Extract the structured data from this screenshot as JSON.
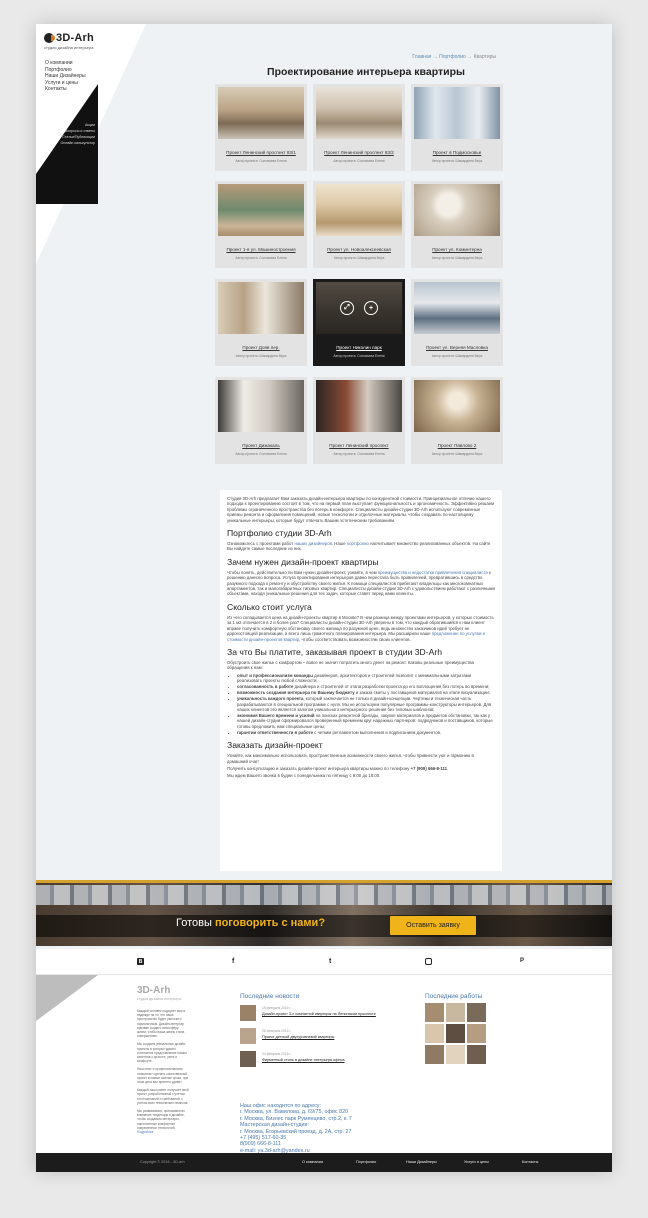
{
  "sidebar": {
    "logo": "3D-Arh",
    "logo_sub": "студия дизайна интерьера",
    "menu_top": [
      "О компании",
      "Портфолио",
      "Наши Дизайнеры",
      "Услуги и цены",
      "Контакты"
    ],
    "menu_bottom": [
      "Акции",
      "Вопросы и ответы",
      "Статьи/Публикации",
      "Онлайн калькулятор"
    ]
  },
  "breadcrumb": {
    "home": "Главная",
    "sep1": " → ",
    "portfolio": "Портфолио",
    "sep2": " → ",
    "current": "Квартиры"
  },
  "page_title": "Проектирование интерьера квартиры",
  "projects": [
    {
      "name": "Проект Ленинский проспект 83/1",
      "author": "Автор проекта: Соловьева Елена"
    },
    {
      "name": "Проект Ленинский проспект 83/2",
      "author": "Автор проекта: Соловьева Елена"
    },
    {
      "name": "Проект в Подмосковье",
      "author": "Автор проекта: Шамардина Вера"
    },
    {
      "name": "Проект 1-я ул. Машиностроения",
      "author": "Автор проекта: Соловьева Елена"
    },
    {
      "name": "Проект ул. Новоалексеевская",
      "author": "Автор проекта: Шамардина Вера"
    },
    {
      "name": "Проект ул. Коминтерна",
      "author": "Автор проекта: Шамардина Вера"
    },
    {
      "name": "Проект Дояв пер.",
      "author": "Автор проекта: Шамардина Вера"
    },
    {
      "name": "Проект Николин парк",
      "author": "Автор проекта: Соловьева Елена"
    },
    {
      "name": "Проект ул. Верняя Масловка",
      "author": "Автор проекта: Шамардина Вера"
    },
    {
      "name": "Проект Дижакаль",
      "author": "Автор проекта: Соловьева Елена"
    },
    {
      "name": "Проект Ленинский проспект",
      "author": "Автор проекта: Соловьева Елена"
    },
    {
      "name": "Проект Павлово 2",
      "author": "Автор проекта: Шамардина Вера"
    }
  ],
  "article": {
    "intro": "Студия 3D-Arh предлагает Вам заказать дизайн-интерьера квартиры по конкурентной стоимости. Принципиальное отличие нашего подхода к проектированию состоит в том, что на первый план выступает функциональность и эргономичность. Эффективно решаем проблемы ограниченного пространства без потерь в комфорте. Специалисты дизайн-студии 3D-Arh используют современные приемы ремонта и оформления помещений, новые технологии и отделочные материалы, чтобы создавать по-настоящему уникальные интерьеры, которые будут отвечать Вашим эстетическим требованиям.",
    "h1": "Портфолио студии 3D-Arh",
    "p1_a": "Ознакомьтесь с проектами работ ",
    "p1_link1": "наших дизайнеров",
    "p1_b": ". Наше ",
    "p1_link2": "портфолио",
    "p1_c": " насчитывает множество реализованных объектов. На сайте Вы найдете самые последние из них.",
    "h2": "Зачем нужен дизайн-проект квартиры",
    "p2_a": "Чтобы понять, действительно ли Вам нужен дизайн-проект, узнайте, в чем ",
    "p2_link": "преимущества и недостатки привлечения специалиста",
    "p2_b": " к решению данного вопроса. Услуга проектирования интерьеров давно перестала быть привилегией, превратившись в средство разумного подхода к ремонту и обустройству своего жилья. К помощи специалистов прибегают владельцы как многокомнатных апартаментов, так и малогабаритных типовых квартир. Специалисты дизайн-студии 3D-Arh с удовольствием работают с различными объектами, находя уникальные решения для тех задач, которые ставят перед нами клиенты.",
    "h3": "Сколько стоит услуга",
    "p3_a": "Из чего складывается цена на дизайн-проекты квартир в Москве? В чем разница между проектами интерьеров, у которых стоимость за 1 м2 отличается в 2 и более раз? Специалисты дизайн-студии 3D-Arh уверены в том, что каждый обратившийся к нам клиент вправе получить комфортную обстановку своего жилища по разумной цене, ведь множество заказчиков идей требует не дорогостоящей реализации, а всего лишь грамотного планирования интерьера. Мы расширили наше ",
    "p3_link": "предложение по услугам и стоимости дизайн-проектов квартир",
    "p3_b": ", чтобы соответствовать возможностям своих клиентов.",
    "h4": "За что Вы платите, заказывая проект в студии 3D-Arh",
    "p4": "Обустроить свое жилье с комфортом – вовсе не значит потратить много денег на ремонт. Каковы реальные преимущества обращения к нам:",
    "list": [
      {
        "b": "опыт и профессионализм команды",
        "t": " дизайнеров, архитекторов и строителей позволит с минимальными затратами реализовать проекты любой сложности;"
      },
      {
        "b": "согласованность в работе",
        "t": " дизайнера и строителей от этапа разработки проекта до его воплощения без потерь во времени;"
      },
      {
        "b": "возможность создания интерьера по Вашему бюджету",
        "t": " и заказа сметы у поставщиков материалов на этапе визуализации;"
      },
      {
        "b": "уникальность каждого проекта",
        "t": ", который заключается не только в дизайн-концепции. Чертежи и техническая часть разрабатываются в специальной программе с нуля. Мы не используем популярные программы-конструкторы интерьеров. Для наших клиентов это является залогом уникального интерьерного решения без типовых шаблонов;"
      },
      {
        "b": "экономия Вашего времени и усилий",
        "t": " на поисках ремонтной бригады, закупке материалов и предметов обстановки, так как у нашей дизайн-студии сформировался проверенный временем круг надежных партнеров: подрядчиков и поставщиков, которые готовы предложить нам специальные цены;"
      },
      {
        "b": "гарантии ответственности в работе",
        "t": " с четким регламентом выполнения и подписанием документов."
      }
    ],
    "h5": "Заказать дизайн-проект",
    "p5": "Узнайте, как максимально использовать пространственные возможности своего жилья, чтобы привнести уют и гармонию в домашний очаг!",
    "p6_a": "Получить консультацию и заказать дизайн-проект интерьера квартиры можно по телефону ",
    "p6_phone": "+7 (909) 666-8-111",
    "p6_b": ".",
    "p7": "Мы ждем Вашего звонка в будни с понедельника по пятницу с 9:00 до 18:00."
  },
  "banner": {
    "text": "Готовы ",
    "highlight": "поговорить с нами?",
    "button": "Оставить заявку"
  },
  "social": {
    "vk": "В",
    "fb": "f",
    "tw": "t",
    "pin": "P"
  },
  "footer": {
    "logo": "3D-Arh",
    "logo_sub": "студия дизайна интерьера",
    "about": [
      "Каждый человек ощущает мир в надежде на то, что наше пространство будет уютным и гармоничным. Дизайн-интерьер призван создать атмосферу жизни, чтобы ваша жизнь стала совершеннее.",
      "Мы создаем уникальные дизайн-проекты в которых удачно сочетается представление наших клиентов о красоте, уюте и комфорте.",
      "Наш опыт и профессионализм позволяют сделать качественный проект в самые сжатые сроки, при этом цена вас приятно удивит.",
      "Каждый наш клиент получает свой проект, разработанный с учетом его пожеланий и требований, с учетом всех технических нюансов.",
      "Мы развиваемся, принимаем во внимание тенденции в дизайне, чтобы создавать интерьеры, наполненные комфортом современных технологий."
    ],
    "about_link": "Подробнее",
    "news_title": "Последние новости",
    "news": [
      {
        "date": "19 февраля 2016 г.",
        "title": "Дизайн-проект 3-х комнатной квартиры на Ленинском проспекте"
      },
      {
        "date": "08 февраля 2016 г.",
        "title": "Проект детской двухуровневой квартиры"
      },
      {
        "date": "04 февраля 2016 г.",
        "title": "Фирменный стиль в дизайне интерьера офиса"
      }
    ],
    "works_title": "Последние работы",
    "office": [
      "Наш офис находится по адресу:",
      "г. Москва, ул. Вавилова, д. 69/75, офис 820",
      "г. Москва, Бизнес парк Румянцево, стр.2, к. Г",
      "Мастерская дизайн-студии:",
      "г. Москва, Егорьевский проезд, д. 2А, стр. 27",
      "+7 (495) 517-60-35",
      "8(909) 666-8-111",
      "e-mail: ya.3d-arh@yandex.ru"
    ]
  },
  "bottom": {
    "copyright": "Copyright © 2016 - 3D-arh",
    "menu": [
      "О компании",
      "Портфолио",
      "Наши Дизайнеры",
      "Услуги и цены",
      "Контакты"
    ]
  },
  "colors": {
    "accent": "#f0b41b",
    "link": "#4a78b0",
    "dark": "#1c1c1c"
  }
}
